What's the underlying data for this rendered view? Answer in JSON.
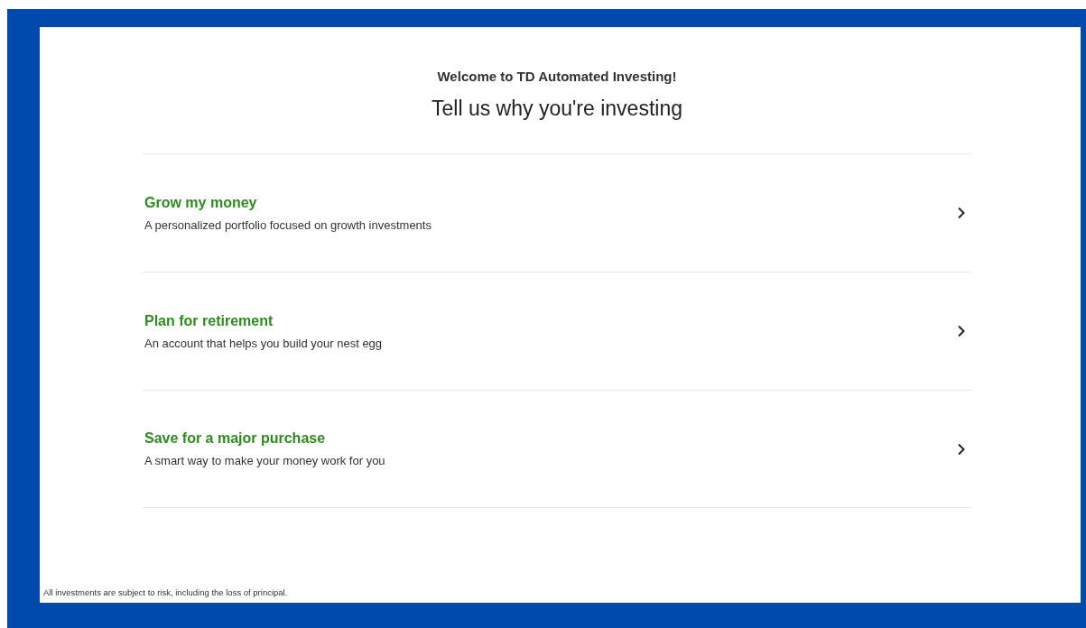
{
  "header": {
    "welcome": "Welcome to TD Automated Investing!",
    "title": "Tell us why you're investing"
  },
  "goals": [
    {
      "title": "Grow my money",
      "description": "A personalized portfolio focused on growth investments"
    },
    {
      "title": "Plan for retirement",
      "description": "An account that helps you build your nest egg"
    },
    {
      "title": "Save for a major purchase",
      "description": "A smart way to make your money work for you"
    }
  ],
  "disclaimer": "All investments are subject to risk, including the loss of principal."
}
